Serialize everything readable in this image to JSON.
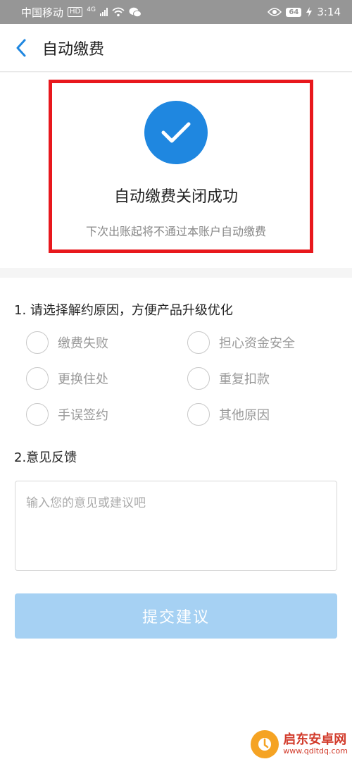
{
  "status_bar": {
    "carrier": "中国移动",
    "hd": "HD",
    "network": "4G",
    "battery": "64",
    "time": "3:14"
  },
  "nav": {
    "title": "自动缴费"
  },
  "result": {
    "title": "自动缴费关闭成功",
    "subtitle": "下次出账起将不通过本账户自动缴费"
  },
  "question1": {
    "title": "1. 请选择解约原因，方便产品升级优化",
    "options": [
      "缴费失败",
      "担心资金安全",
      "更换住处",
      "重复扣款",
      "手误签约",
      "其他原因"
    ]
  },
  "question2": {
    "title": "2.意见反馈",
    "placeholder": "输入您的意见或建议吧",
    "value": ""
  },
  "submit": {
    "label": "提交建议"
  },
  "watermark": {
    "name": "启东安卓网",
    "url": "www.qdltdq.com"
  },
  "colors": {
    "accent": "#1f87e0",
    "highlight": "#e8181d",
    "button_disabled": "#a6d1f3"
  }
}
